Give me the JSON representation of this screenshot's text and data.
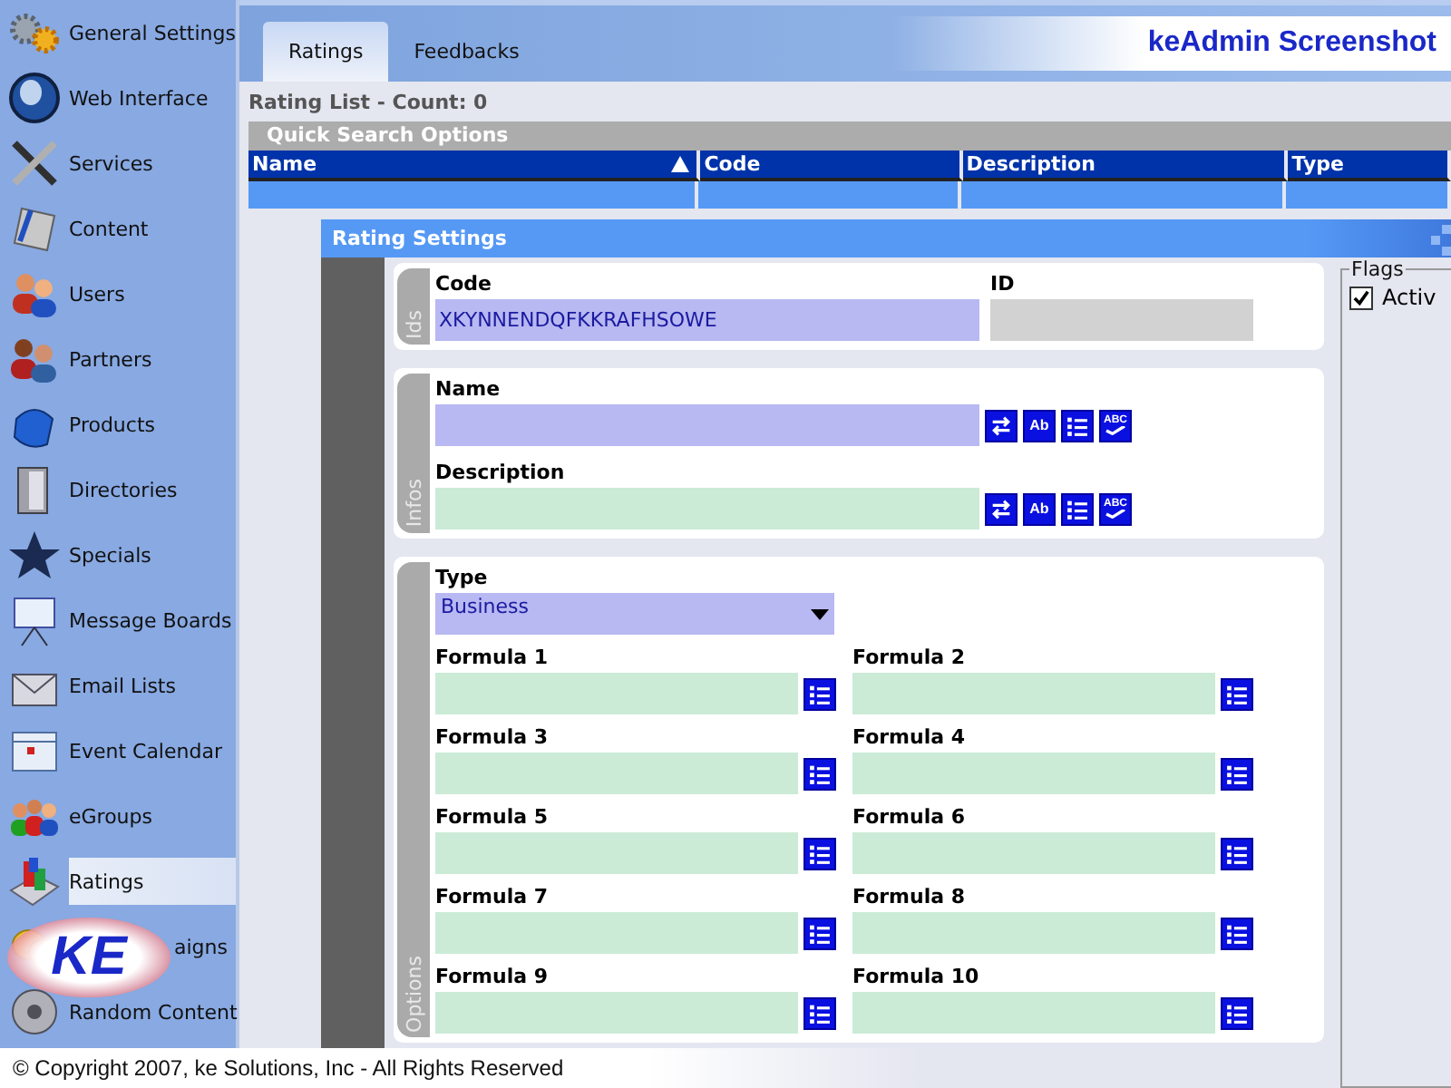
{
  "sidebar": {
    "items": [
      {
        "label": "General Settings",
        "selected": false
      },
      {
        "label": "Web Interface",
        "selected": false
      },
      {
        "label": "Services",
        "selected": false
      },
      {
        "label": "Content",
        "selected": false
      },
      {
        "label": "Users",
        "selected": false
      },
      {
        "label": "Partners",
        "selected": false
      },
      {
        "label": "Products",
        "selected": false
      },
      {
        "label": "Directories",
        "selected": false
      },
      {
        "label": "Specials",
        "selected": false
      },
      {
        "label": "Message Boards",
        "selected": false
      },
      {
        "label": "Email Lists",
        "selected": false
      },
      {
        "label": "Event Calendar",
        "selected": false
      },
      {
        "label": "eGroups",
        "selected": false
      },
      {
        "label": "Ratings",
        "selected": true
      },
      {
        "label": "aigns",
        "selected": false
      },
      {
        "label": "Random Content",
        "selected": false
      }
    ]
  },
  "logo": {
    "text": "KE"
  },
  "tabs": [
    {
      "label": "Ratings",
      "selected": true
    },
    {
      "label": "Feedbacks",
      "selected": false
    }
  ],
  "header": {
    "title": "keAdmin Screenshot"
  },
  "list": {
    "title": "Rating List - Count: 0"
  },
  "quick_search": {
    "title": "Quick Search Options"
  },
  "table": {
    "columns": [
      {
        "label": "Name",
        "sorted": true
      },
      {
        "label": "Code",
        "sorted": false
      },
      {
        "label": "Description",
        "sorted": false
      },
      {
        "label": "Type",
        "sorted": false
      }
    ]
  },
  "dialog": {
    "title": "Rating Settings",
    "groups": [
      {
        "tab": "Ids",
        "fields": [
          {
            "label": "Code",
            "kind": "text",
            "required": true,
            "value": "XKYNNENDQFKKRAFHSOWE"
          },
          {
            "label": "ID",
            "kind": "readonly"
          }
        ]
      },
      {
        "tab": "Infos",
        "fields": [
          {
            "label": "Name",
            "kind": "text",
            "required": true,
            "tools": [
              {
                "kind": "swap"
              },
              {
                "kind": "format",
                "label": "Ab"
              },
              {
                "kind": "list"
              },
              {
                "kind": "spell",
                "label": "ABC"
              }
            ]
          },
          {
            "label": "Description",
            "kind": "text",
            "required": false,
            "tools": [
              {
                "kind": "swap"
              },
              {
                "kind": "format",
                "label": "Ab"
              },
              {
                "kind": "list"
              },
              {
                "kind": "spell",
                "label": "ABC"
              }
            ]
          }
        ]
      },
      {
        "tab": "Options",
        "fields": [
          {
            "label": "Type",
            "kind": "select",
            "required": true,
            "value": "Business"
          },
          {
            "label": "Formula 1",
            "kind": "text",
            "required": false,
            "tools": [
              {
                "kind": "list"
              }
            ]
          },
          {
            "label": "Formula 2",
            "kind": "text",
            "required": false,
            "tools": [
              {
                "kind": "list"
              }
            ]
          },
          {
            "label": "Formula 3",
            "kind": "text",
            "required": false,
            "tools": [
              {
                "kind": "list"
              }
            ]
          },
          {
            "label": "Formula 4",
            "kind": "text",
            "required": false,
            "tools": [
              {
                "kind": "list"
              }
            ]
          },
          {
            "label": "Formula 5",
            "kind": "text",
            "required": false,
            "tools": [
              {
                "kind": "list"
              }
            ]
          },
          {
            "label": "Formula 6",
            "kind": "text",
            "required": false,
            "tools": [
              {
                "kind": "list"
              }
            ]
          },
          {
            "label": "Formula 7",
            "kind": "text",
            "required": false,
            "tools": [
              {
                "kind": "list"
              }
            ]
          },
          {
            "label": "Formula 8",
            "kind": "text",
            "required": false,
            "tools": [
              {
                "kind": "list"
              }
            ]
          },
          {
            "label": "Formula 9",
            "kind": "text",
            "required": false,
            "tools": [
              {
                "kind": "list"
              }
            ]
          },
          {
            "label": "Formula 10",
            "kind": "text",
            "required": false,
            "tools": [
              {
                "kind": "list"
              }
            ]
          }
        ]
      }
    ],
    "flags": {
      "title": "Flags",
      "items": [
        {
          "label": "Activ",
          "checked": true
        }
      ]
    }
  },
  "footer": {
    "copyright": "© Copyright 2007, ke Solutions, Inc - All Rights Reserved"
  }
}
